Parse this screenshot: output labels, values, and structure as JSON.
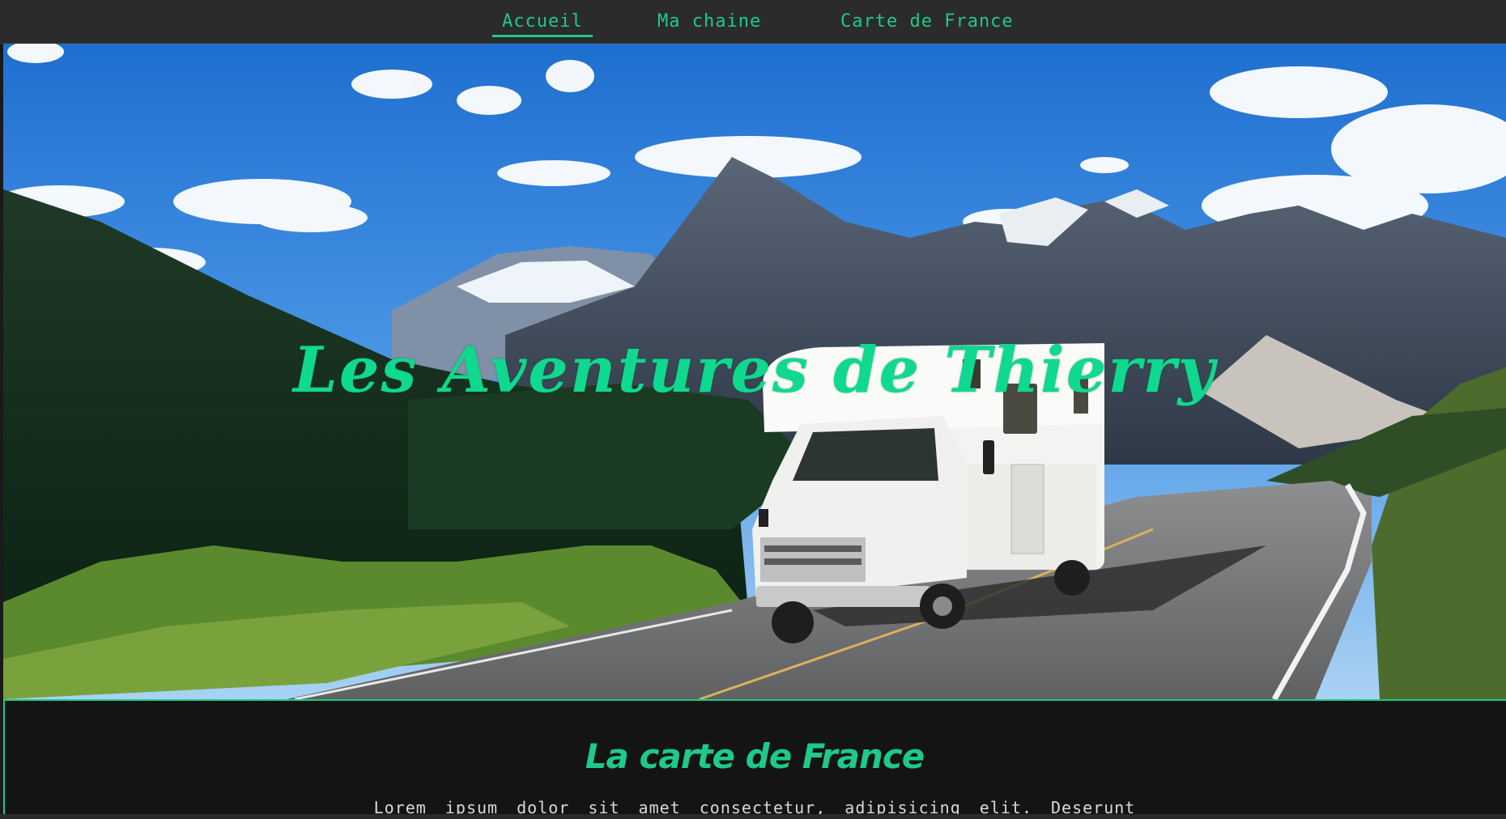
{
  "nav": {
    "items": [
      {
        "label": "Accueil",
        "active": true
      },
      {
        "label": "Ma chaine",
        "active": false
      },
      {
        "label": "Carte de France",
        "active": false
      }
    ]
  },
  "hero": {
    "title": "Les Aventures de Thierry"
  },
  "section": {
    "title": "La carte de France",
    "text": "Lorem ipsum dolor sit amet consectetur, adipisicing elit. Deserunt"
  },
  "colors": {
    "accent": "#1ec98a",
    "nav_background": "#2b2b2b",
    "section_background": "#141414"
  }
}
